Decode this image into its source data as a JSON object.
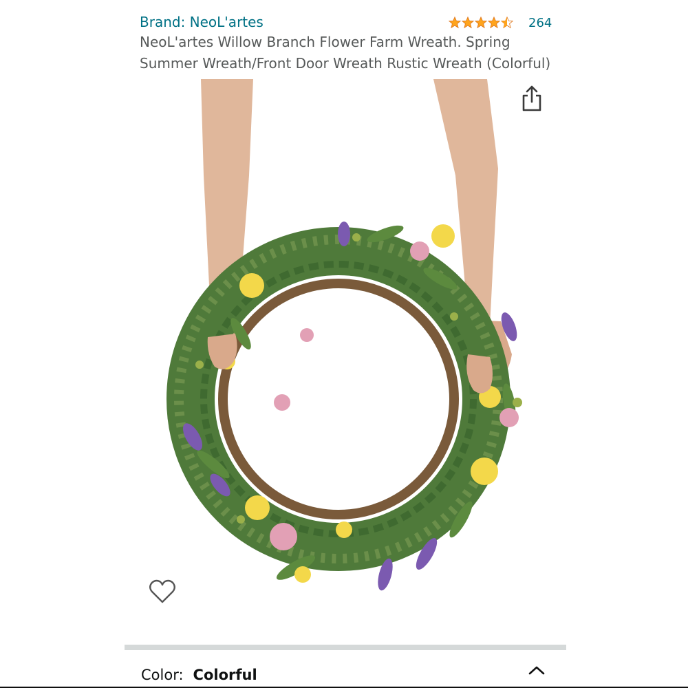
{
  "product": {
    "brand_label": "Brand: NeoL'artes",
    "title": "NeoL'artes Willow Branch Flower Farm Wreath. Spring Summer Wreath/Front Door Wreath Rustic Wreath (Colorful)",
    "rating": {
      "stars_value": 4.5,
      "stars_max": 5,
      "count": "264"
    },
    "image_icon": "wreath-product-photo"
  },
  "actions": {
    "share_icon": "share-icon",
    "wishlist_icon": "heart-outline-icon",
    "collapse_icon": "chevron-up-icon"
  },
  "variation": {
    "label": "Color:",
    "value": "Colorful"
  },
  "colors": {
    "link": "#007185",
    "star": "#ffa41c",
    "text": "#0f1111",
    "muted": "#565959",
    "divider": "#d5d9d9"
  }
}
